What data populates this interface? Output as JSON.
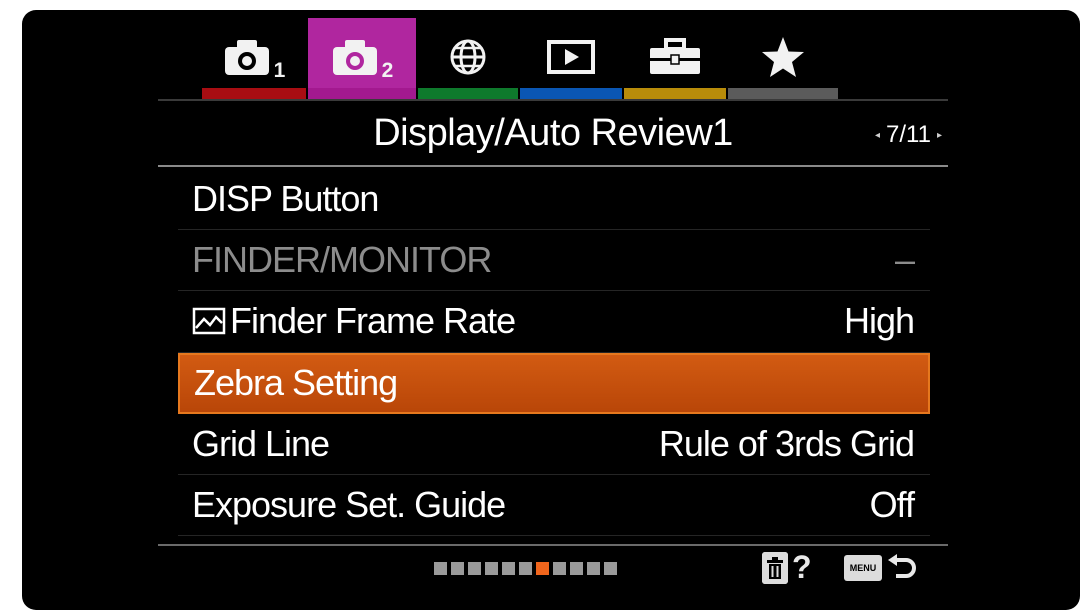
{
  "tabs": [
    {
      "id": "camera-1",
      "icon": "camera-icon",
      "number": "1",
      "stripe_color": "#a80d12",
      "active": false
    },
    {
      "id": "camera-2",
      "icon": "camera-icon",
      "number": "2",
      "stripe_color": "#a3198f",
      "active": true,
      "active_bg": "#b0269f"
    },
    {
      "id": "network",
      "icon": "globe-icon",
      "number": "",
      "stripe_color": "#0e7a2c",
      "active": false
    },
    {
      "id": "playback",
      "icon": "playback-icon",
      "number": "",
      "stripe_color": "#0a56b3",
      "active": false
    },
    {
      "id": "setup",
      "icon": "toolbox-icon",
      "number": "",
      "stripe_color": "#b88c0a",
      "active": false
    },
    {
      "id": "my-menu",
      "icon": "star-icon",
      "number": "",
      "stripe_color": "#5b5b5b",
      "active": false
    }
  ],
  "header": {
    "title": "Display/Auto Review1",
    "page": "7/11",
    "page_left_arrow": "◂",
    "page_right_arrow": "▸"
  },
  "menu": {
    "items": [
      {
        "label": "DISP Button",
        "value": "",
        "state": "normal"
      },
      {
        "label": "FINDER/MONITOR",
        "value": "–",
        "state": "disabled"
      },
      {
        "label": "Finder Frame Rate",
        "value": "High",
        "state": "normal",
        "icon": "movie-frame-icon"
      },
      {
        "label": "Zebra Setting",
        "value": "",
        "state": "selected"
      },
      {
        "label": "Grid Line",
        "value": "Rule of 3rds Grid",
        "state": "normal"
      },
      {
        "label": "Exposure Set. Guide",
        "value": "Off",
        "state": "normal"
      }
    ]
  },
  "footer": {
    "page_dots_total": 11,
    "page_dots_active": 7,
    "help_label": "?",
    "menu_key_label": "MENU",
    "icons": [
      "trash-icon",
      "help-icon",
      "menu-key-icon",
      "back-icon"
    ]
  },
  "colors": {
    "selected_bg": "#c4500c",
    "selected_border": "#e6781e",
    "active_dot": "#f0651c"
  }
}
